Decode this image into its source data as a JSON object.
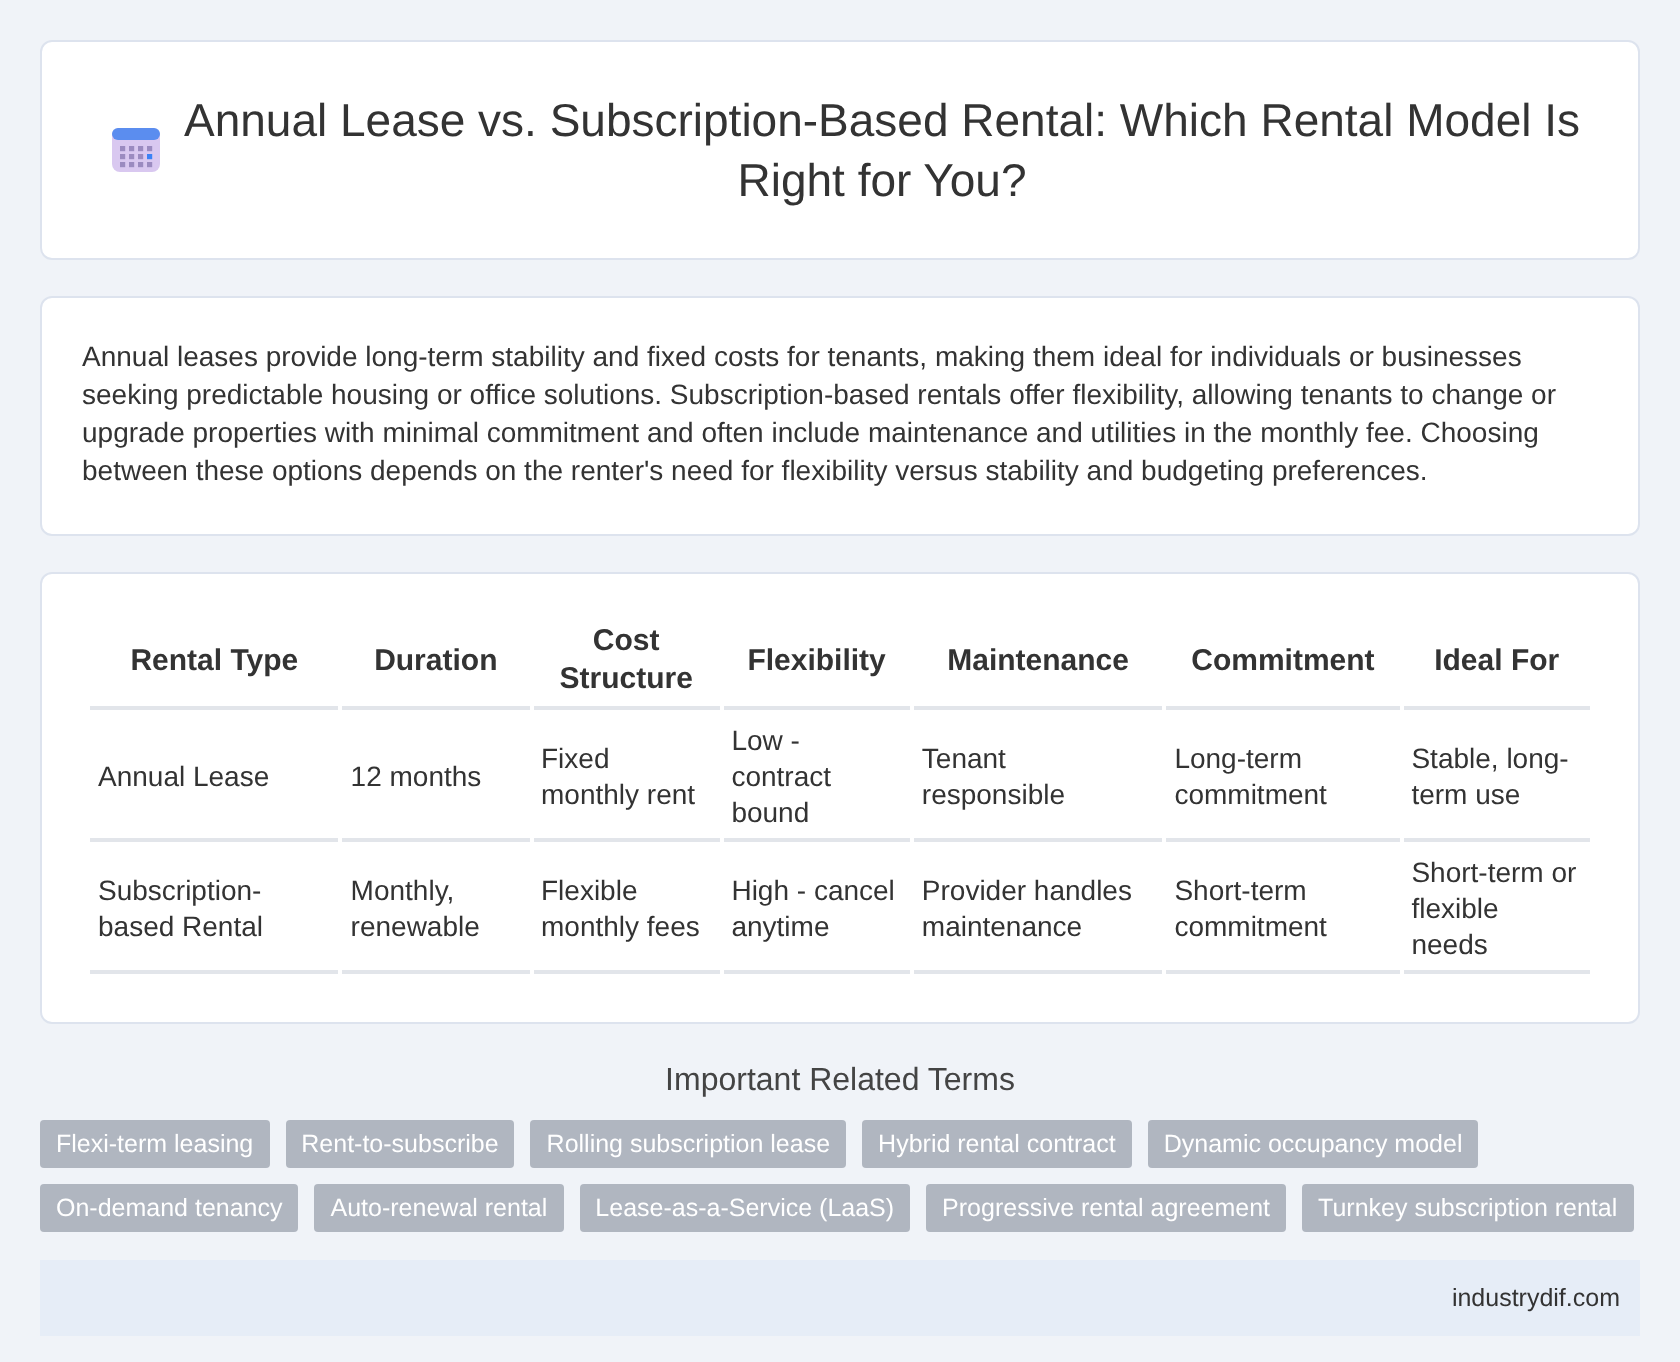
{
  "header": {
    "title": "Annual Lease vs. Subscription-Based Rental: Which Rental Model Is Right for You?"
  },
  "intro": "Annual leases provide long-term stability and fixed costs for tenants, making them ideal for individuals or businesses seeking predictable housing or office solutions. Subscription-based rentals offer flexibility, allowing tenants to change or upgrade properties with minimal commitment and often include maintenance and utilities in the monthly fee. Choosing between these options depends on the renter's need for flexibility versus stability and budgeting preferences.",
  "table": {
    "columns": [
      "Rental Type",
      "Duration",
      "Cost Structure",
      "Flexibility",
      "Maintenance",
      "Commitment",
      "Ideal For"
    ],
    "rows": [
      [
        "Annual Lease",
        "12 months",
        "Fixed monthly rent",
        "Low - contract bound",
        "Tenant responsible",
        "Long-term commitment",
        "Stable, long-term use"
      ],
      [
        "Subscription-based Rental",
        "Monthly, renewable",
        "Flexible monthly fees",
        "High - cancel anytime",
        "Provider handles maintenance",
        "Short-term commitment",
        "Short-term or flexible needs"
      ]
    ]
  },
  "related": {
    "title": "Important Related Terms",
    "tags": [
      "Flexi-term leasing",
      "Rent-to-subscribe",
      "Rolling subscription lease",
      "Hybrid rental contract",
      "Dynamic occupancy model",
      "On-demand tenancy",
      "Auto-renewal rental",
      "Lease-as-a-Service (LaaS)",
      "Progressive rental agreement",
      "Turnkey subscription rental"
    ]
  },
  "footer": "industrydif.com"
}
